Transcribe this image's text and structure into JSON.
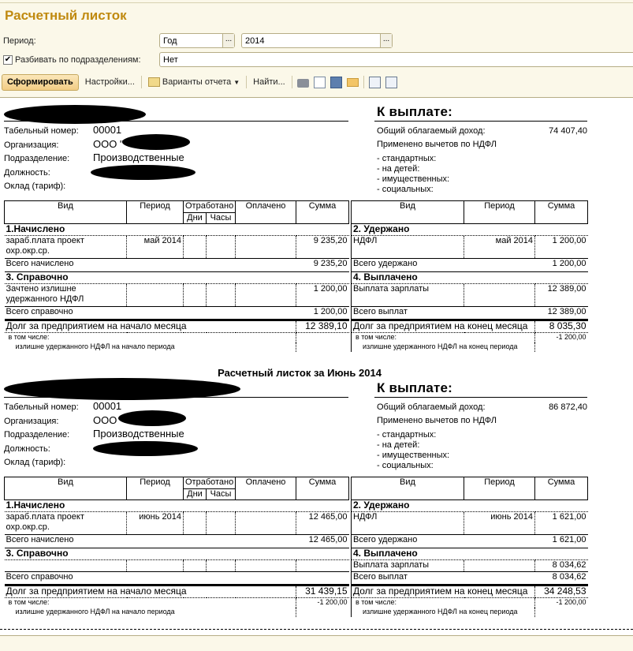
{
  "window": {
    "title": "Расчетный листок"
  },
  "form": {
    "period_label": "Период:",
    "period_type": "Год",
    "period_value": "2014",
    "split_label": "Разбивать по подразделениям:",
    "split_checked": true,
    "split_value": "Нет",
    "dots": "..."
  },
  "toolbar": {
    "generate": "Сформировать",
    "settings": "Настройки...",
    "variants": "Варианты отчета",
    "find": "Найти...",
    "icons": [
      "print-icon",
      "preview-icon",
      "save-icon",
      "mail-icon",
      "copy-icon",
      "paste-icon"
    ]
  },
  "labels": {
    "tab_no": "Табельный номер:",
    "org": "Организация:",
    "division": "Подразделение:",
    "position": "Должность:",
    "rate": "Оклад (тариф):",
    "to_pay": "К выплате:",
    "income": "Общий облагаемый доход:",
    "deductions": "Применено вычетов по НДФЛ",
    "ded_standard": "- стандартных:",
    "ded_children": "- на детей:",
    "ded_property": "- имущественных:",
    "ded_social": "- социальных:",
    "col_type": "Вид",
    "col_period": "Период",
    "col_worked": "Отработано",
    "col_days": "Дни",
    "col_hours": "Часы",
    "col_paid": "Оплачено",
    "col_sum": "Сумма",
    "accrued": "1.Начислено",
    "withheld": "2. Удержано",
    "reference": "3. Справочно",
    "paid_out": "4. Выплачено",
    "total_accrued": "Всего начислено",
    "total_withheld": "Всего удержано",
    "total_reference": "Всего справочно",
    "total_paid": "Всего выплат",
    "debt_start": "Долг за предприятием на начало месяца",
    "debt_end": "Долг за предприятием на конец месяца",
    "including": "в том числе:",
    "excess_start": "излишне удержанного НДФЛ на начало периода",
    "excess_end": "излишне удержанного НДФЛ на конец периода"
  },
  "slips": [
    {
      "title": "",
      "tab_no": "00001",
      "org": "ООО \"",
      "division": "Производственные",
      "income": "74 407,40",
      "accrued": [
        {
          "type": "зараб.плата проект охр.окр.ср.",
          "period": "май 2014",
          "days": "",
          "hours": "",
          "paid": "",
          "sum": "9 235,20"
        }
      ],
      "accrued_total": "9 235,20",
      "withheld": [
        {
          "type": "НДФЛ",
          "period": "май 2014",
          "sum": "1 200,00"
        }
      ],
      "withheld_total": "1 200,00",
      "reference": [
        {
          "type": "Зачтено излишне удержанного НДФЛ",
          "period": "",
          "days": "",
          "hours": "",
          "paid": "",
          "sum": "1 200,00"
        }
      ],
      "reference_total": "1 200,00",
      "paid_out": [
        {
          "type": "Выплата зарплаты",
          "period": "",
          "sum": "12 389,00"
        }
      ],
      "paid_total": "12 389,00",
      "debt_start": "12 389,10",
      "debt_start_incl": "",
      "debt_end": "8 035,30",
      "debt_end_incl": "-1 200,00"
    },
    {
      "title": "Расчетный листок за Июнь 2014",
      "tab_no": "00001",
      "org": "ООО \"",
      "division": "Производственные",
      "income": "86 872,40",
      "accrued": [
        {
          "type": "зараб.плата проект охр.окр.ср.",
          "period": "июнь 2014",
          "days": "",
          "hours": "",
          "paid": "",
          "sum": "12 465,00"
        }
      ],
      "accrued_total": "12 465,00",
      "withheld": [
        {
          "type": "НДФЛ",
          "period": "июнь 2014",
          "sum": "1 621,00"
        }
      ],
      "withheld_total": "1 621,00",
      "reference": [
        {
          "type": "",
          "period": "",
          "days": "",
          "hours": "",
          "paid": "",
          "sum": ""
        }
      ],
      "reference_total": "",
      "paid_out": [
        {
          "type": "Выплата зарплаты",
          "period": "",
          "sum": "8 034,62"
        }
      ],
      "paid_total": "8 034,62",
      "debt_start": "31 439,15",
      "debt_start_incl": "-1 200,00",
      "debt_end": "34 248,53",
      "debt_end_incl": "-1 200,00"
    }
  ]
}
